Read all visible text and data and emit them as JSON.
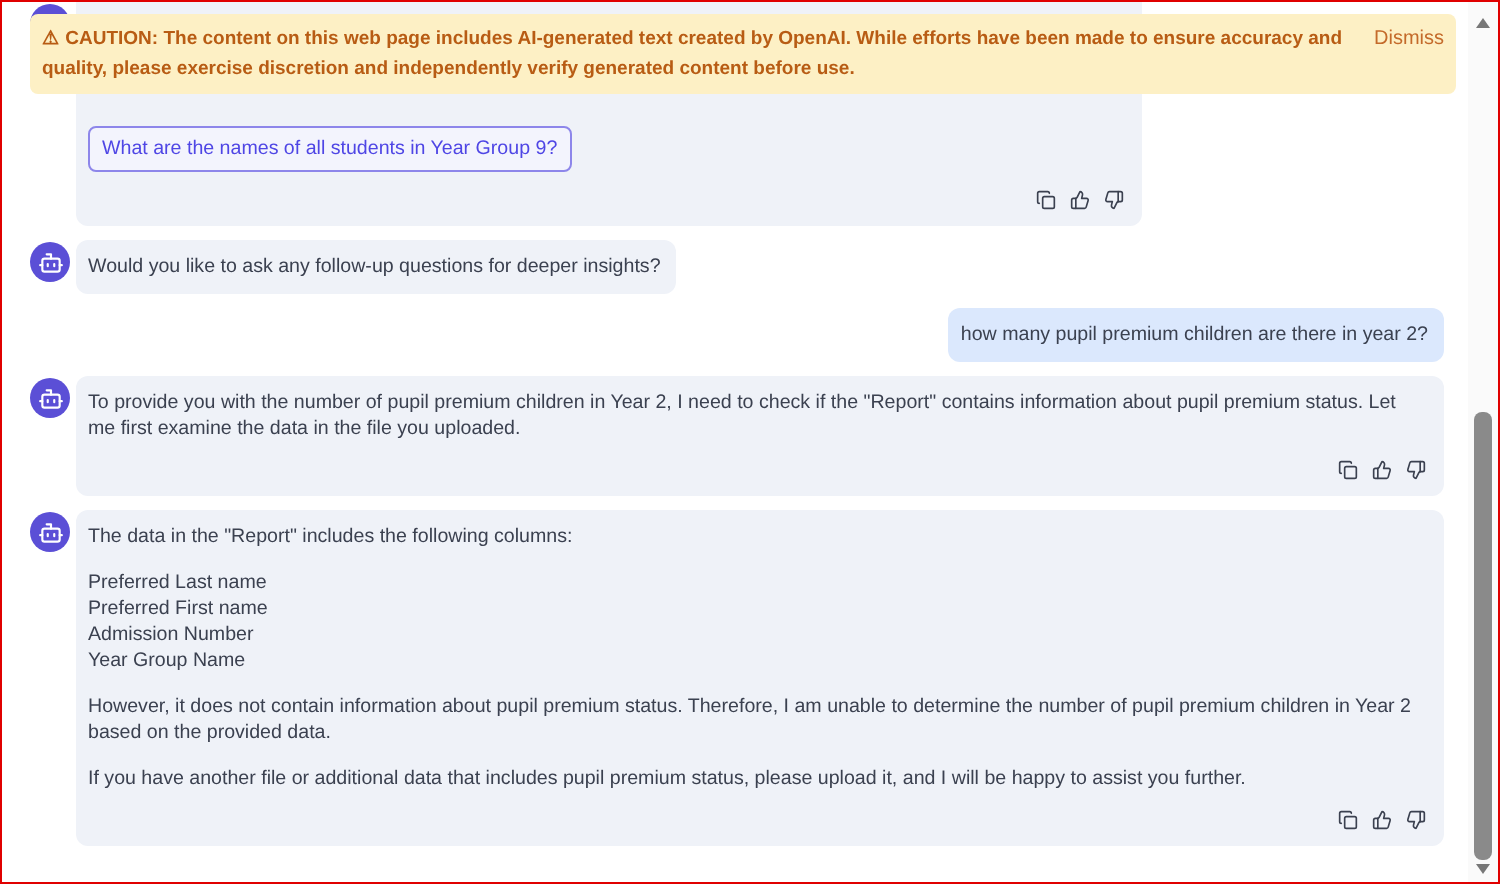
{
  "banner": {
    "text": "⚠ CAUTION: The content on this web page includes AI-generated text created by OpenAI. While efforts have been made to ensure accuracy and quality, please exercise discretion and independently verify generated content before use.",
    "dismiss": "Dismiss"
  },
  "messages": [
    {
      "kind": "bot",
      "suggestions": [
        "What are the names of all students in Year Group 9?"
      ],
      "actions": true
    },
    {
      "kind": "bot",
      "blocks": [
        [
          "Would you like to ask any follow-up questions for deeper insights?"
        ]
      ],
      "actions": false
    },
    {
      "kind": "user",
      "blocks": [
        [
          "how many pupil premium children are there in year 2?"
        ]
      ],
      "actions": false
    },
    {
      "kind": "bot",
      "blocks": [
        [
          "To provide you with the number of pupil premium children in Year 2, I need to check if the \"Report\" contains information about pupil premium status. Let me first examine the data in the file you uploaded."
        ]
      ],
      "actions": true
    },
    {
      "kind": "bot",
      "blocks": [
        [
          "The data in the \"Report\" includes the following columns:"
        ],
        [
          "Preferred Last name",
          "Preferred First name",
          "Admission Number",
          "Year Group Name"
        ],
        [
          "However, it does not contain information about pupil premium status. Therefore, I am unable to determine the number of pupil premium children in Year 2 based on the provided data."
        ],
        [
          "If you have another file or additional data that includes pupil premium status, please upload it, and I will be happy to assist you further."
        ]
      ],
      "actions": true
    }
  ]
}
